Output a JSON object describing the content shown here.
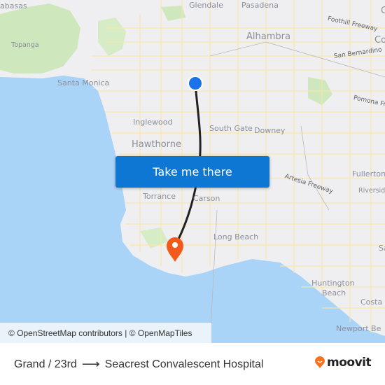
{
  "map": {
    "places": [
      {
        "name": "abasas",
        "kind": "med"
      },
      {
        "name": "Topanga",
        "kind": "small"
      },
      {
        "name": "Glendale",
        "kind": "med"
      },
      {
        "name": "Pasadena",
        "kind": "med"
      },
      {
        "name": "Alhambra",
        "kind": "big"
      },
      {
        "name": "Co",
        "kind": "big"
      },
      {
        "name": "Santa Monica",
        "kind": "med"
      },
      {
        "name": "Inglewood",
        "kind": "med"
      },
      {
        "name": "Hawthorne",
        "kind": "big"
      },
      {
        "name": "South Gate",
        "kind": "med"
      },
      {
        "name": "Downey",
        "kind": "med"
      },
      {
        "name": "Torrance",
        "kind": "med"
      },
      {
        "name": "Carson",
        "kind": "med"
      },
      {
        "name": "Long Beach",
        "kind": "med"
      },
      {
        "name": "Fullerton",
        "kind": "med"
      },
      {
        "name": "Riverside",
        "kind": "small"
      },
      {
        "name": "Sa",
        "kind": "med"
      },
      {
        "name": "Huntington",
        "kind": "med"
      },
      {
        "name": "Beach",
        "kind": "med"
      },
      {
        "name": "Costa I",
        "kind": "med"
      },
      {
        "name": "Newport Be",
        "kind": "med"
      },
      {
        "name": "C",
        "kind": "big"
      }
    ],
    "roads": [
      {
        "name": "Foothill Freeway"
      },
      {
        "name": "San Bernardino"
      },
      {
        "name": "Pomona Fr"
      },
      {
        "name": "Artesia Freeway"
      }
    ],
    "origin_marker": {
      "label": "Grand / 23rd",
      "color": "#1a73e8"
    },
    "destination_marker": {
      "label": "Seacrest Convalescent Hospital",
      "color": "#f25a1c"
    },
    "route_color": "#222222"
  },
  "cta": {
    "label": "Take me there"
  },
  "attribution": "© OpenStreetMap contributors | © OpenMapTiles",
  "footer": {
    "origin": "Grand / 23rd",
    "arrow": "⟶",
    "destination": "Seacrest Convalescent Hospital",
    "brand": "moovit",
    "brand_color": "#f5731f"
  }
}
